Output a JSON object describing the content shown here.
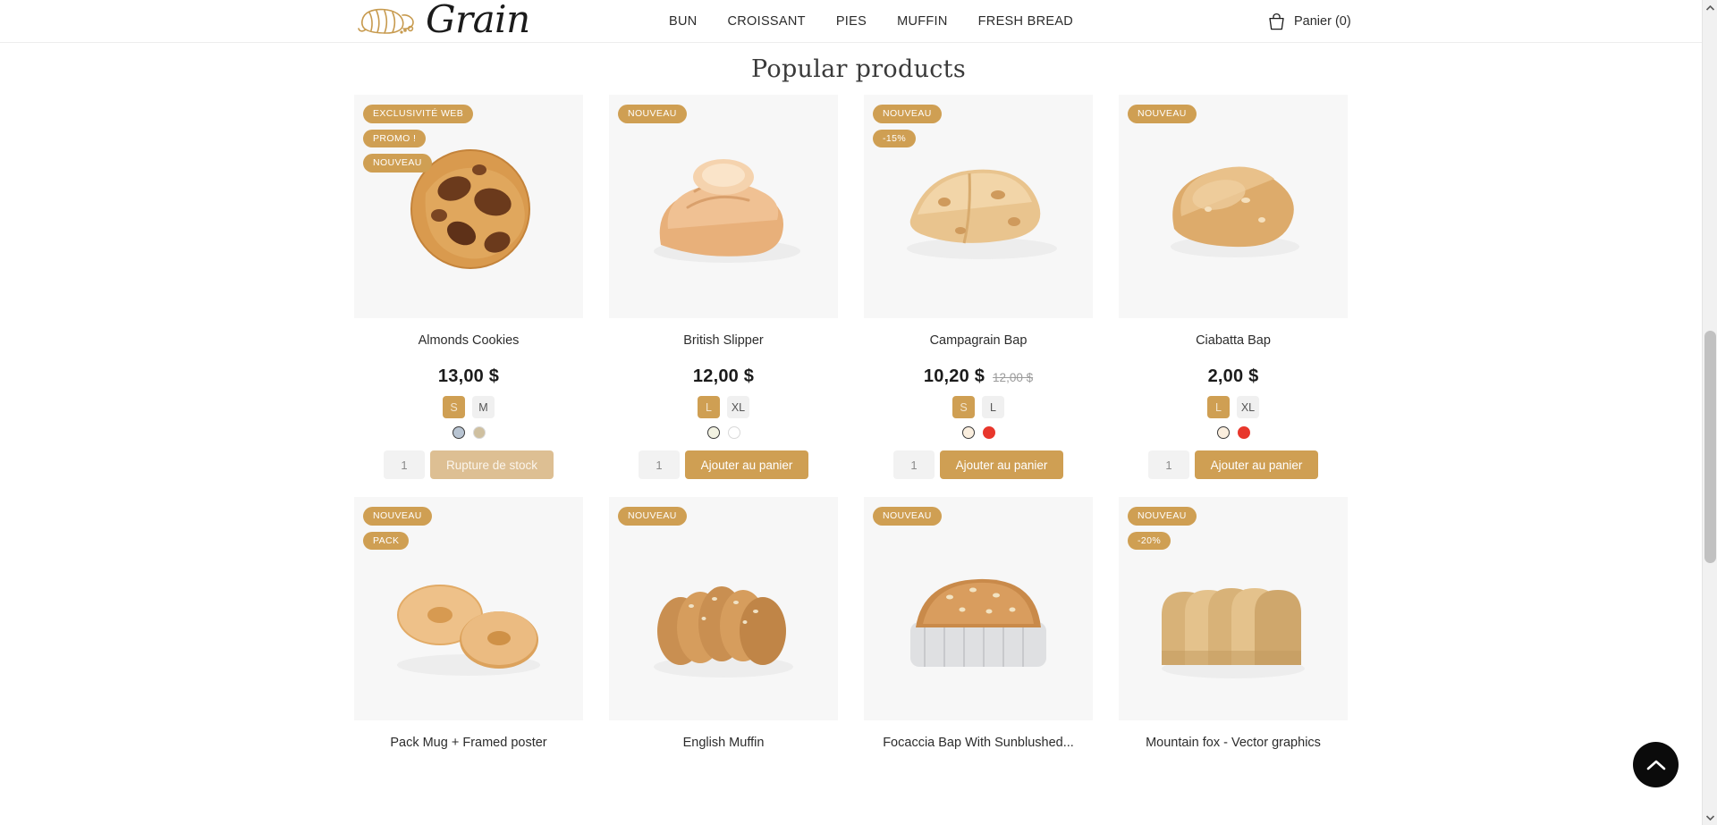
{
  "header": {
    "logo_text": "Grain",
    "logo_icon": "croissant-icon",
    "nav": [
      {
        "label": "BUN"
      },
      {
        "label": "CROISSANT"
      },
      {
        "label": "PIES"
      },
      {
        "label": "MUFFIN"
      },
      {
        "label": "FRESH BREAD"
      }
    ],
    "cart": {
      "icon": "shopping-basket-icon",
      "label": "Panier (0)",
      "count": 0
    }
  },
  "main": {
    "section_title": "Popular products"
  },
  "colors": {
    "accent": "#cf9f53",
    "accent_disabled": "#ddbf93",
    "badge_bg": "#cf9f53",
    "card_media_bg": "#f7f7f7",
    "page_bg": "#ffffff"
  },
  "products": [
    {
      "title": "Almonds Cookies",
      "badges": [
        "EXCLUSIVITÉ WEB",
        "PROMO !",
        "NOUVEAU"
      ],
      "price": "13,00 $",
      "price_old": "",
      "sizes": [
        {
          "label": "S",
          "selected": true
        },
        {
          "label": "M",
          "selected": false
        }
      ],
      "swatches": [
        {
          "hex": "#b8c4d2",
          "selected": true
        },
        {
          "hex": "#cfc0a0",
          "selected": false
        }
      ],
      "qty": "1",
      "button": "Rupture de stock",
      "in_stock": false,
      "image": "chocolate-chip-cookie"
    },
    {
      "title": "British Slipper",
      "badges": [
        "NOUVEAU"
      ],
      "price": "12,00 $",
      "price_old": "",
      "sizes": [
        {
          "label": "L",
          "selected": true
        },
        {
          "label": "XL",
          "selected": false
        }
      ],
      "swatches": [
        {
          "hex": "#f2f2e2",
          "selected": true
        },
        {
          "hex": "#ffffff",
          "selected": false
        }
      ],
      "qty": "1",
      "button": "Ajouter au panier",
      "in_stock": true,
      "image": "white-bread-loaves"
    },
    {
      "title": "Campagrain Bap",
      "badges": [
        "NOUVEAU",
        "-15%"
      ],
      "price": "10,20 $",
      "price_old": "12,00 $",
      "sizes": [
        {
          "label": "S",
          "selected": true
        },
        {
          "label": "L",
          "selected": false
        }
      ],
      "swatches": [
        {
          "hex": "#faeede",
          "selected": true
        },
        {
          "hex": "#e8372c",
          "selected": false
        }
      ],
      "qty": "1",
      "button": "Ajouter au panier",
      "in_stock": true,
      "image": "flatbread-focaccia"
    },
    {
      "title": "Ciabatta Bap",
      "badges": [
        "NOUVEAU"
      ],
      "price": "2,00 $",
      "price_old": "",
      "sizes": [
        {
          "label": "L",
          "selected": true
        },
        {
          "label": "XL",
          "selected": false
        }
      ],
      "swatches": [
        {
          "hex": "#faeede",
          "selected": true
        },
        {
          "hex": "#e8372c",
          "selected": false
        }
      ],
      "qty": "1",
      "button": "Ajouter au panier",
      "in_stock": true,
      "image": "ciabatta-roll"
    },
    {
      "title": "Pack Mug + Framed poster",
      "badges": [
        "NOUVEAU",
        "PACK"
      ],
      "price": "",
      "price_old": "",
      "sizes": [],
      "swatches": [],
      "qty": "",
      "button": "",
      "in_stock": true,
      "image": "bagels"
    },
    {
      "title": "English Muffin",
      "badges": [
        "NOUVEAU"
      ],
      "price": "",
      "price_old": "",
      "sizes": [],
      "swatches": [],
      "qty": "",
      "button": "",
      "in_stock": true,
      "image": "sliced-seeded-bread"
    },
    {
      "title": "Focaccia Bap With Sunblushed...",
      "badges": [
        "NOUVEAU"
      ],
      "price": "",
      "price_old": "",
      "sizes": [],
      "swatches": [],
      "qty": "",
      "button": "",
      "in_stock": true,
      "image": "loaf-in-basket"
    },
    {
      "title": "Mountain fox - Vector graphics",
      "badges": [
        "NOUVEAU",
        "-20%"
      ],
      "price": "",
      "price_old": "",
      "sizes": [],
      "swatches": [],
      "qty": "",
      "button": "",
      "in_stock": true,
      "image": "sliced-white-bread"
    }
  ],
  "scroll_top": {
    "icon": "chevron-up-icon"
  }
}
